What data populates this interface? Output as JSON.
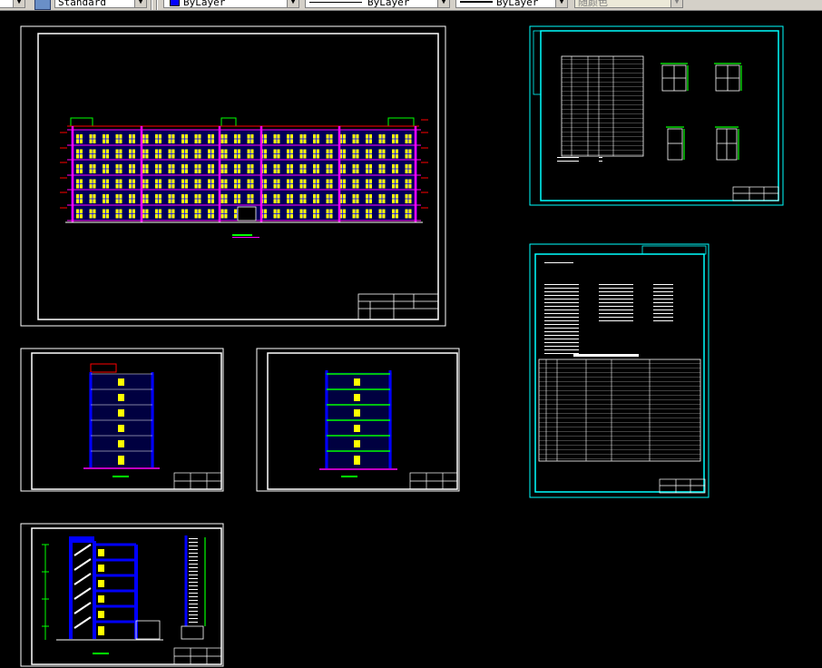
{
  "toolbar": {
    "text_style": "Standard",
    "layer_color": "ByLayer",
    "linetype": "ByLayer",
    "lineweight": "ByLayer",
    "plot_style": "随颜色"
  },
  "colors": {
    "background": "#000000",
    "frame": "#ffffff",
    "cyan_frame": "#00ffff",
    "facade_blue": "#0000ff",
    "window_yellow": "#ffff00",
    "dimension_red": "#ff0000",
    "accent_magenta": "#ff00ff",
    "green": "#00ff00"
  },
  "sheets": [
    {
      "id": "main-elevation",
      "frame_color": "white"
    },
    {
      "id": "window-schedule",
      "frame_color": "cyan"
    },
    {
      "id": "design-notes",
      "frame_color": "cyan"
    },
    {
      "id": "side-elevation-left",
      "frame_color": "white"
    },
    {
      "id": "side-elevation-right",
      "frame_color": "white"
    },
    {
      "id": "section",
      "frame_color": "white"
    }
  ]
}
